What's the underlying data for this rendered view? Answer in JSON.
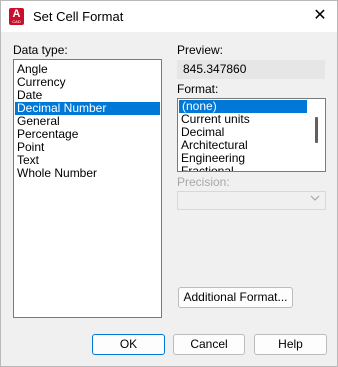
{
  "window": {
    "title": "Set Cell Format",
    "app_icon_letter": "A",
    "app_icon_sub": "CAD",
    "close_symbol": "✕"
  },
  "data_type": {
    "label": "Data type:",
    "items": [
      "Angle",
      "Currency",
      "Date",
      "Decimal Number",
      "General",
      "Percentage",
      "Point",
      "Text",
      "Whole Number"
    ],
    "selected": "Decimal Number"
  },
  "preview": {
    "label": "Preview:",
    "value": "845.347860"
  },
  "format": {
    "label": "Format:",
    "items": [
      "(none)",
      "Current units",
      "Decimal",
      "Architectural",
      "Engineering",
      "Fractional"
    ],
    "selected": "(none)"
  },
  "precision": {
    "label": "Precision:",
    "value": ""
  },
  "buttons": {
    "additional_format": "Additional Format...",
    "ok": "OK",
    "cancel": "Cancel",
    "help": "Help"
  },
  "colors": {
    "selection": "#0078d7",
    "autodesk_red": "#c8102e"
  }
}
